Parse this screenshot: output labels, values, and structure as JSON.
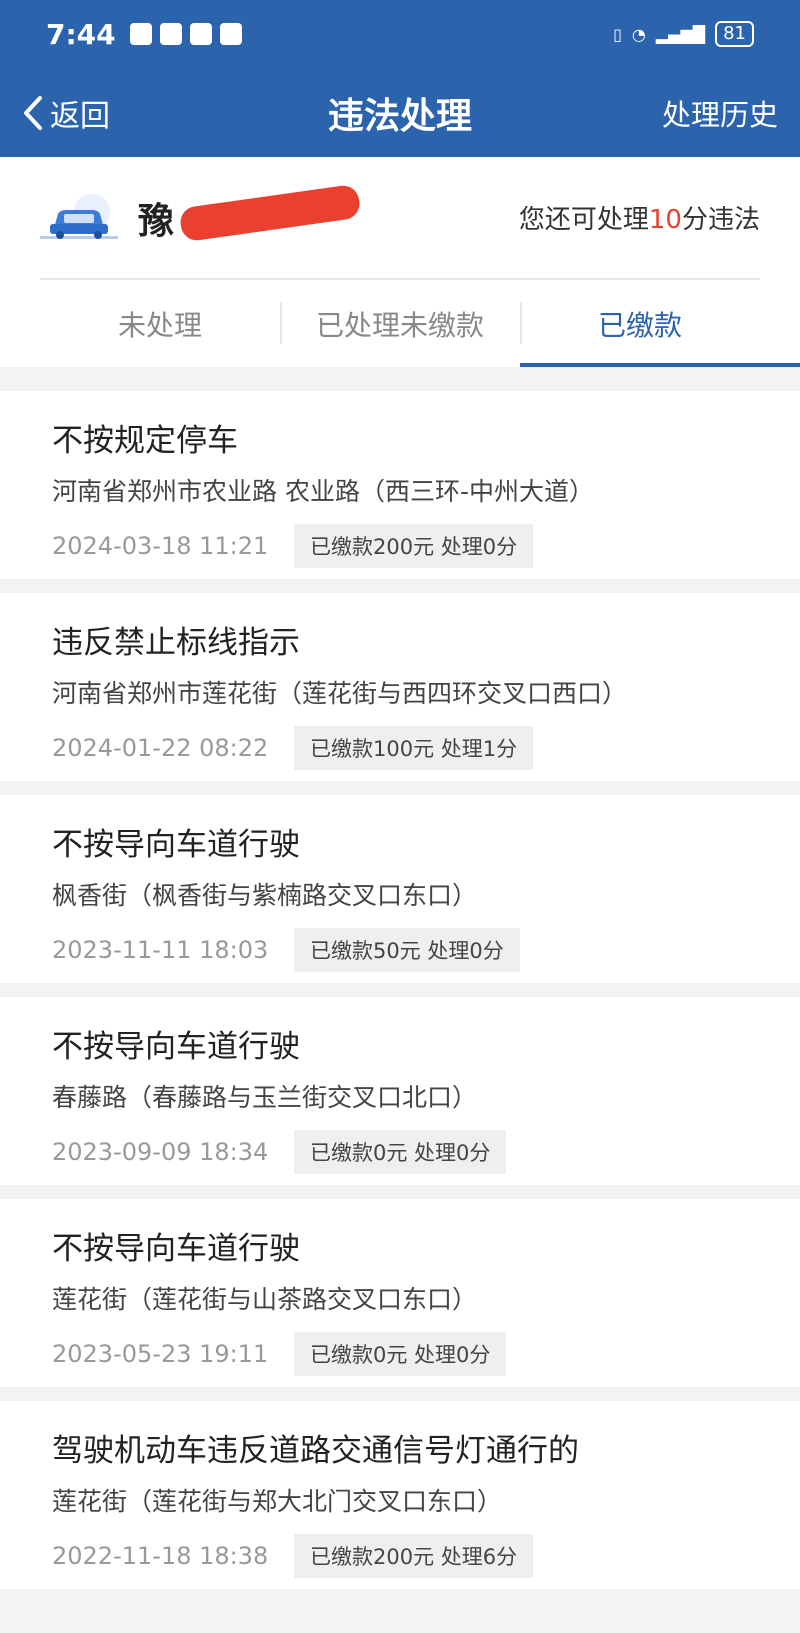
{
  "status_bar": {
    "time": "7:44",
    "battery": "81"
  },
  "nav": {
    "back_label": "返回",
    "title": "违法处理",
    "history_label": "处理历史"
  },
  "vehicle": {
    "plate_visible": "豫",
    "points_prefix": "您还可处理",
    "points_value": "10",
    "points_suffix": "分违法"
  },
  "tabs": [
    {
      "label": "未处理",
      "active": false
    },
    {
      "label": "已处理未缴款",
      "active": false
    },
    {
      "label": "已缴款",
      "active": true
    }
  ],
  "violations": [
    {
      "title": "不按规定停车",
      "address": "河南省郑州市农业路 农业路（西三环-中州大道）",
      "time": "2024-03-18 11:21",
      "status": "已缴款200元 处理0分"
    },
    {
      "title": "违反禁止标线指示",
      "address": "河南省郑州市莲花街（莲花街与西四环交叉口西口）",
      "time": "2024-01-22 08:22",
      "status": "已缴款100元 处理1分"
    },
    {
      "title": "不按导向车道行驶",
      "address": "枫香街（枫香街与紫楠路交叉口东口）",
      "time": "2023-11-11 18:03",
      "status": "已缴款50元 处理0分"
    },
    {
      "title": "不按导向车道行驶",
      "address": "春藤路（春藤路与玉兰街交叉口北口）",
      "time": "2023-09-09 18:34",
      "status": "已缴款0元 处理0分"
    },
    {
      "title": "不按导向车道行驶",
      "address": "莲花街（莲花街与山茶路交叉口东口）",
      "time": "2023-05-23 19:11",
      "status": "已缴款0元 处理0分"
    },
    {
      "title": "驾驶机动车违反道路交通信号灯通行的",
      "address": "莲花街（莲花街与郑大北门交叉口东口）",
      "time": "2022-11-18 18:38",
      "status": "已缴款200元 处理6分"
    }
  ],
  "colors": {
    "brand_blue": "#2b63ad",
    "accent_red": "#e9402f"
  }
}
